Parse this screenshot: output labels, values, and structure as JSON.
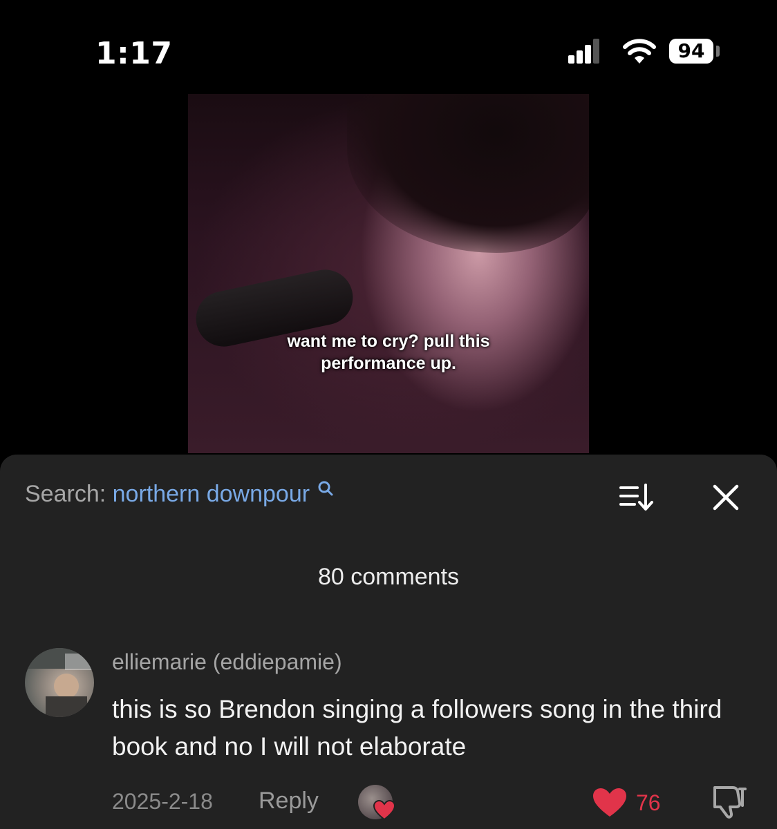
{
  "status_bar": {
    "time": "1:17",
    "battery_level": "94",
    "signal_icon": "cellular-signal-icon",
    "wifi_icon": "wifi-icon"
  },
  "video": {
    "caption_line1": "want me to cry? pull this",
    "caption_line2": "performance up."
  },
  "search": {
    "label": "Search:",
    "query": "northern downpour",
    "icon": "search-icon"
  },
  "toolbar": {
    "sort_icon": "sort-icon",
    "close_icon": "close-icon"
  },
  "comments": {
    "count_label": "80 comments",
    "items": [
      {
        "username": "elliemarie (eddiepamie)",
        "text": "this is so Brendon singing a followers song in the third book and no I will not elaborate",
        "date": "2025-2-18",
        "reply_label": "Reply",
        "likes": "76",
        "liked_by_creator": true
      }
    ]
  },
  "colors": {
    "panel_bg": "#222222",
    "search_query": "#79a9e6",
    "like_red": "#e1344a"
  }
}
